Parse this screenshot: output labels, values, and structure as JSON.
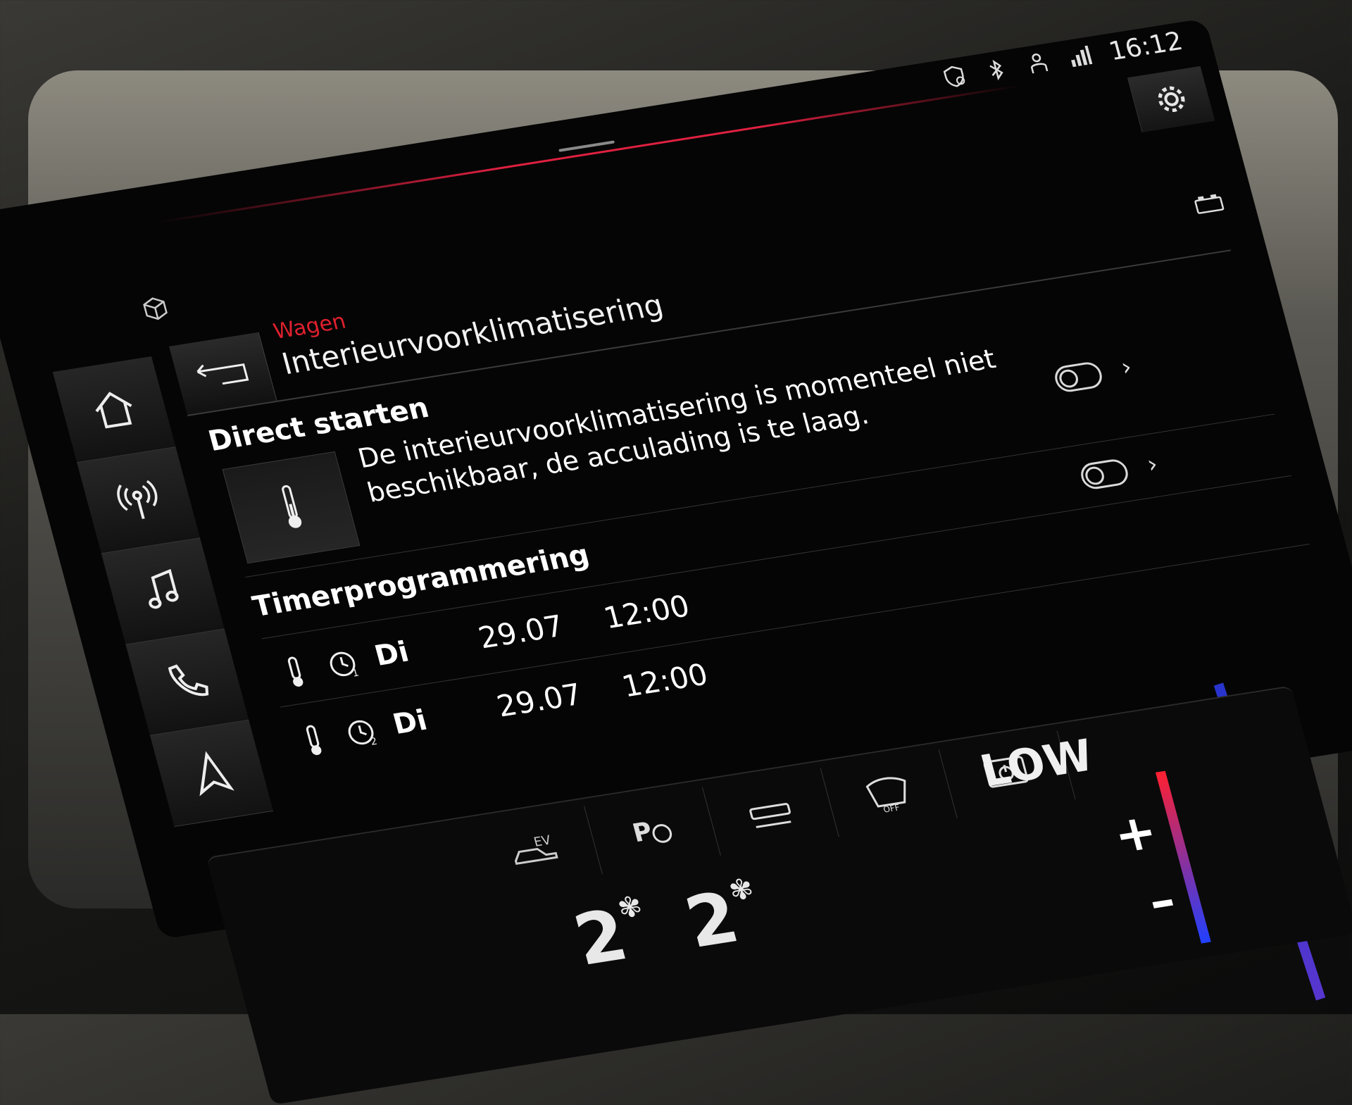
{
  "colors": {
    "accent_red": "#e0202e",
    "text": "#ffffff",
    "background": "#050505"
  },
  "status_bar": {
    "clock": "16:12",
    "icons": [
      "shield-location-icon",
      "bluetooth-icon",
      "user-profile-icon",
      "lte-signal-icon"
    ]
  },
  "sidebar": {
    "items": [
      {
        "icon": "home-icon"
      },
      {
        "icon": "radio-antenna-icon"
      },
      {
        "icon": "music-note-icon"
      },
      {
        "icon": "phone-icon"
      },
      {
        "icon": "navigation-arrow-icon"
      }
    ]
  },
  "header": {
    "breadcrumb": "Wagen",
    "title": "Interieurvoorklimatisering",
    "back_icon": "back-arrow-icon",
    "settings_icon": "gear-icon"
  },
  "direct": {
    "heading": "Direct starten",
    "notice": "De interieurvoorklimatisering is momenteel niet beschikbaar, de acculading is te laag.",
    "toggle_on": false
  },
  "timer": {
    "heading": "Timerprogrammering",
    "toggle_on": false,
    "rows": [
      {
        "clock_number": "1",
        "day": "Di",
        "date": "29.07",
        "time": "12:00"
      },
      {
        "clock_number": "2",
        "day": "Di",
        "date": "29.07",
        "time": "12:00"
      }
    ]
  },
  "climate_panel": {
    "fan_label": "LOW",
    "left_fan": "2",
    "right_fan": "2",
    "plus": "+",
    "minus": "–",
    "buttons": [
      "ev-car-icon",
      "parking-camera-icon",
      "seat-heating-icon",
      "windshield-off-icon",
      "power-monitor-icon"
    ]
  }
}
